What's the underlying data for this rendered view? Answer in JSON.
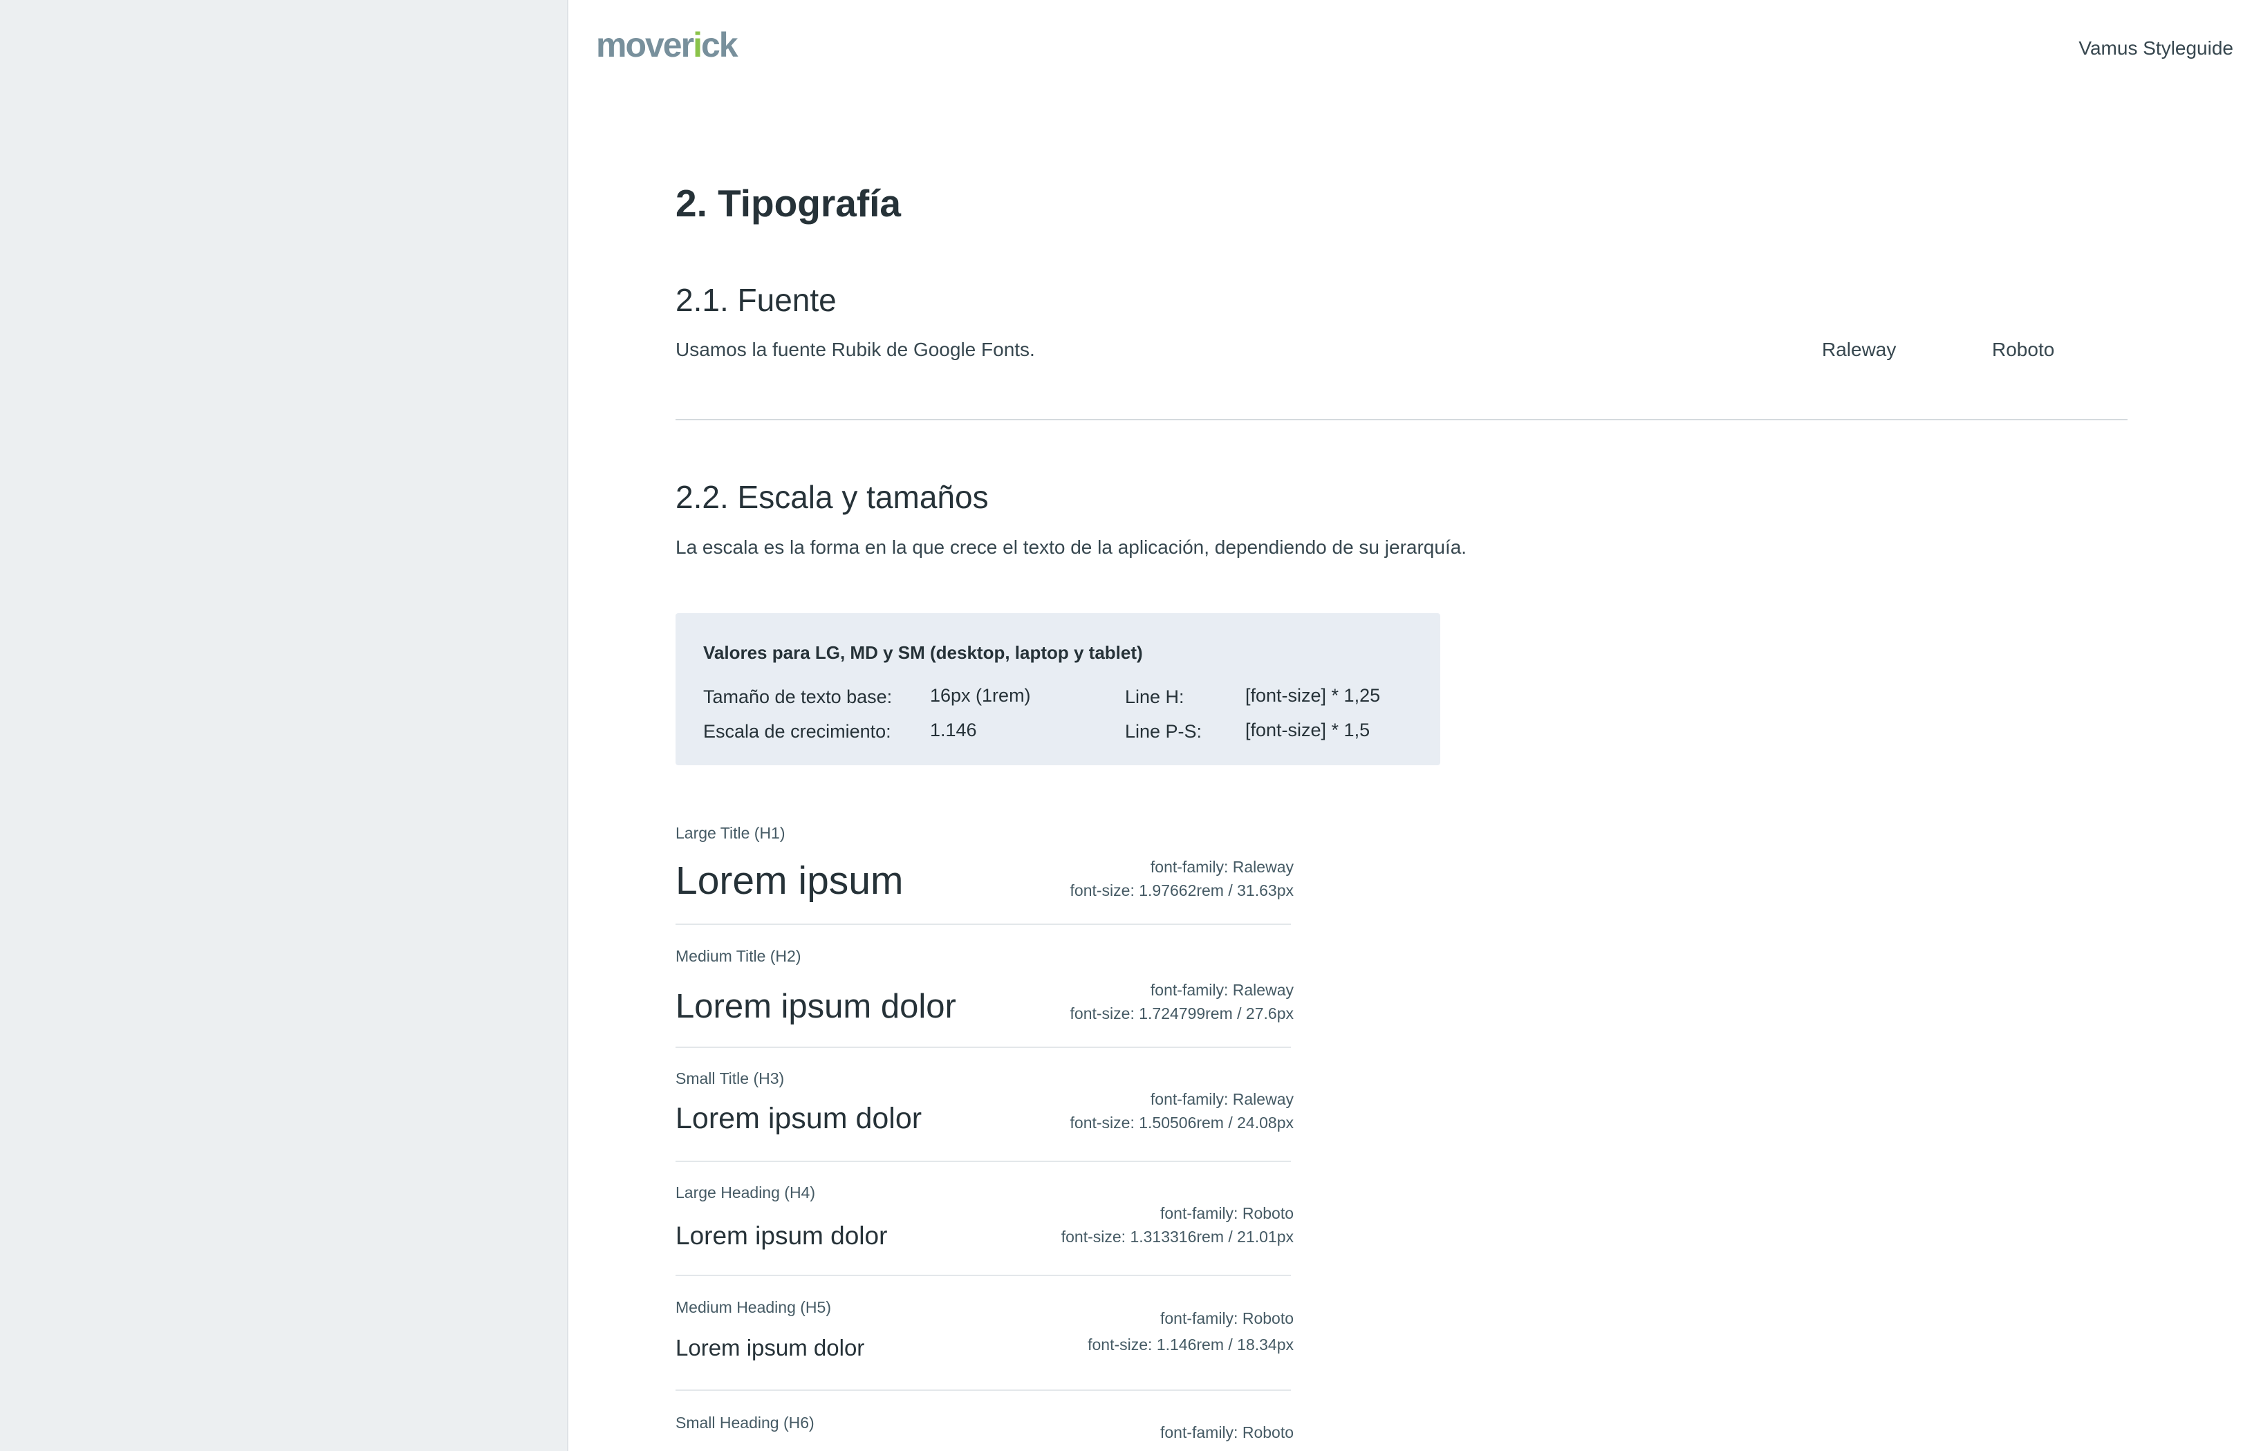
{
  "brand": {
    "logo_text_main": "mover",
    "logo_text_accent": "i",
    "logo_text_end": "ck",
    "accent_color": "#8bc34a"
  },
  "header": {
    "styleguide_link": "Vamus Styleguide"
  },
  "section": {
    "title": "2. Tipografía",
    "font": {
      "title": "2.1. Fuente",
      "description": "Usamos la fuente Rubik de Google Fonts.",
      "samples": [
        "Raleway",
        "Roboto"
      ]
    },
    "scale": {
      "title": "2.2. Escala y tamaños",
      "description": "La escala es la forma en la que crece el texto de la aplicación, dependiendo de su jerarquía.",
      "values_box": {
        "title": "Valores para LG, MD y SM (desktop, laptop y tablet)",
        "base_label": "Tamaño de texto base:",
        "base_value": "16px (1rem)",
        "growth_label": "Escala de crecimiento:",
        "growth_value": "1.146",
        "line_h_label": "Line H:",
        "line_h_value": "[font-size] * 1,25",
        "line_ps_label": "Line P-S:",
        "line_ps_value": "[font-size] * 1,5"
      },
      "type_scale": [
        {
          "label": "Large Title (H1)",
          "sample": "Lorem ipsum",
          "family": "font-family: Raleway",
          "size": "font-size: 1.97662rem / 31.63px"
        },
        {
          "label": "Medium Title (H2)",
          "sample": "Lorem ipsum dolor",
          "family": "font-family: Raleway",
          "size": "font-size: 1.724799rem / 27.6px"
        },
        {
          "label": "Small Title (H3)",
          "sample": "Lorem ipsum dolor",
          "family": "font-family: Raleway",
          "size": "font-size: 1.50506rem / 24.08px"
        },
        {
          "label": "Large Heading (H4)",
          "sample": "Lorem ipsum dolor",
          "family": "font-family: Roboto",
          "size": "font-size: 1.313316rem / 21.01px"
        },
        {
          "label": "Medium Heading (H5)",
          "sample": "Lorem ipsum dolor",
          "family": "font-family: Roboto",
          "size": "font-size: 1.146rem / 18.34px"
        },
        {
          "label": "Small Heading (H6)",
          "family": "font-family: Roboto"
        }
      ]
    }
  }
}
